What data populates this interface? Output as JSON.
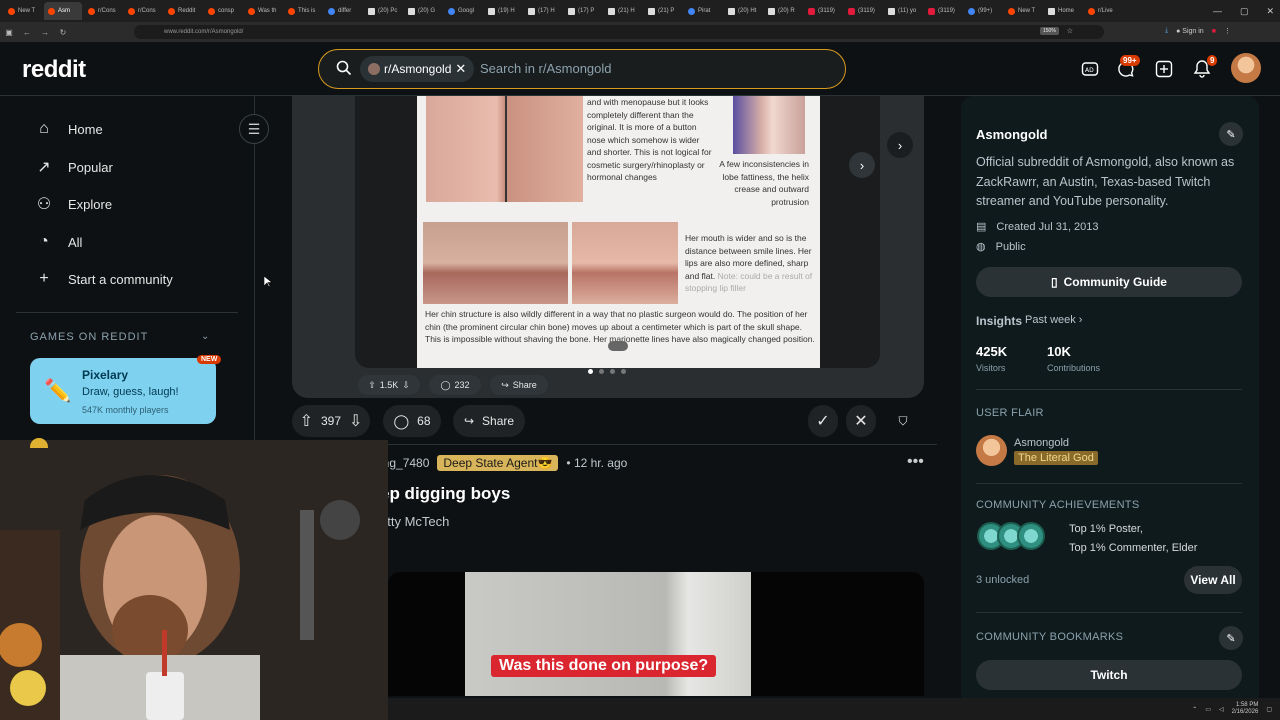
{
  "browser": {
    "tabs": [
      {
        "label": "New T",
        "fav": "reddit"
      },
      {
        "label": "Asm",
        "fav": "reddit",
        "active": true
      },
      {
        "label": "r/Cons",
        "fav": "reddit"
      },
      {
        "label": "r/Cons",
        "fav": "reddit"
      },
      {
        "label": "Reddit",
        "fav": "reddit"
      },
      {
        "label": "consp",
        "fav": "reddit"
      },
      {
        "label": "Was th",
        "fav": "reddit"
      },
      {
        "label": "This is",
        "fav": "reddit"
      },
      {
        "label": "differ",
        "fav": "g"
      },
      {
        "label": "(20) Pc",
        "fav": "x"
      },
      {
        "label": "(20) G",
        "fav": "x"
      },
      {
        "label": "Googl",
        "fav": "g"
      },
      {
        "label": "(19) H",
        "fav": "x"
      },
      {
        "label": "(17) H",
        "fav": "x"
      },
      {
        "label": "(17) P",
        "fav": "x"
      },
      {
        "label": "(21) H",
        "fav": "x"
      },
      {
        "label": "(21) P",
        "fav": "x"
      },
      {
        "label": "Pirat",
        "fav": "g"
      },
      {
        "label": "(20) Ht",
        "fav": "x"
      },
      {
        "label": "(20) R",
        "fav": "x"
      },
      {
        "label": "(3119)",
        "fav": "y"
      },
      {
        "label": "(3119)",
        "fav": "y"
      },
      {
        "label": "(11) yo",
        "fav": "x"
      },
      {
        "label": "(3119)",
        "fav": "y"
      },
      {
        "label": "(99+)",
        "fav": "g"
      },
      {
        "label": "New T",
        "fav": "reddit"
      },
      {
        "label": "Home",
        "fav": "x"
      },
      {
        "label": "r/Live",
        "fav": "reddit"
      }
    ],
    "url": "www.reddit.com/r/Asmongold/",
    "zoom": "150%",
    "signin": "Sign in"
  },
  "header": {
    "logo": "reddit",
    "community_chip": "r/Asmongold",
    "search_placeholder": "Search in r/Asmongold",
    "chat_badge": "99+",
    "notif_badge": "9"
  },
  "left_nav": {
    "items": [
      {
        "label": "Home",
        "icon": "home-icon",
        "glyph": "⌂"
      },
      {
        "label": "Popular",
        "icon": "popular-icon",
        "glyph": "↗"
      },
      {
        "label": "Explore",
        "icon": "explore-icon",
        "glyph": "⚇"
      },
      {
        "label": "All",
        "icon": "all-icon",
        "glyph": "◔"
      },
      {
        "label": "Start a community",
        "icon": "plus-icon",
        "glyph": "+"
      }
    ],
    "games_title": "GAMES ON REDDIT",
    "game": {
      "name": "Pixelary",
      "desc": "Draw, guess, laugh!",
      "players": "547K monthly players",
      "badge": "NEW"
    }
  },
  "post1": {
    "doc_texts": {
      "nose": "and with menopause but it looks completely different than the original. It is more of a button nose which somehow is wider and shorter. This is not logical for cosmetic surgery/rhinoplasty or hormonal changes",
      "ear": "A few inconsistencies in lobe fattiness, the helix crease and outward protrusion",
      "mouth": "Her mouth is wider and so is the distance between smile lines. Her lips are also more defined, sharp and flat.",
      "mouth_note": "Note: could be a result of stopping lip filler",
      "chin": "Her chin structure is also wildly different in a way that no plastic surgeon would do. The position of her chin (the prominent circular chin bone) moves up about a centimeter which is part of the skull shape. This is impossible without shaving the bone. Her marionette lines have also magically changed position."
    },
    "inner_votes": "1.5K",
    "inner_comments": "232",
    "inner_share": "Share",
    "votes": "397",
    "comments": "68",
    "share": "Share",
    "carousel_dots": 4,
    "carousel_active": 1
  },
  "post2": {
    "author": "ing_7480",
    "flair": "Deep State Agent😎",
    "time": "• 12 hr. ago",
    "title": "ep digging boys",
    "subtitle": "atty McTech",
    "caption": "Was this done on purpose?"
  },
  "right_sidebar": {
    "name": "Asmongold",
    "description": "Official subreddit of Asmongold, also known as ZackRawrr, an Austin, Texas-based Twitch streamer and YouTube personality.",
    "created": "Created Jul 31, 2013",
    "visibility": "Public",
    "guide_button": "Community Guide",
    "insights_label": "Insights",
    "insights_range": "Past week ›",
    "visitors_value": "425K",
    "visitors_label": "Visitors",
    "contrib_value": "10K",
    "contrib_label": "Contributions",
    "user_flair_title": "USER FLAIR",
    "flair_user": "Asmongold",
    "flair_tag": "The Literal God",
    "achievements_title": "COMMUNITY ACHIEVEMENTS",
    "ach_line1": "Top 1% Poster,",
    "ach_line2": "Top 1% Commenter, Elder",
    "unlocked": "3 unlocked",
    "view_all": "View All",
    "bookmarks_title": "COMMUNITY BOOKMARKS",
    "bookmark_1": "Twitch"
  },
  "taskbar": {
    "time": "1:58 PM",
    "date": "2/16/2026"
  }
}
